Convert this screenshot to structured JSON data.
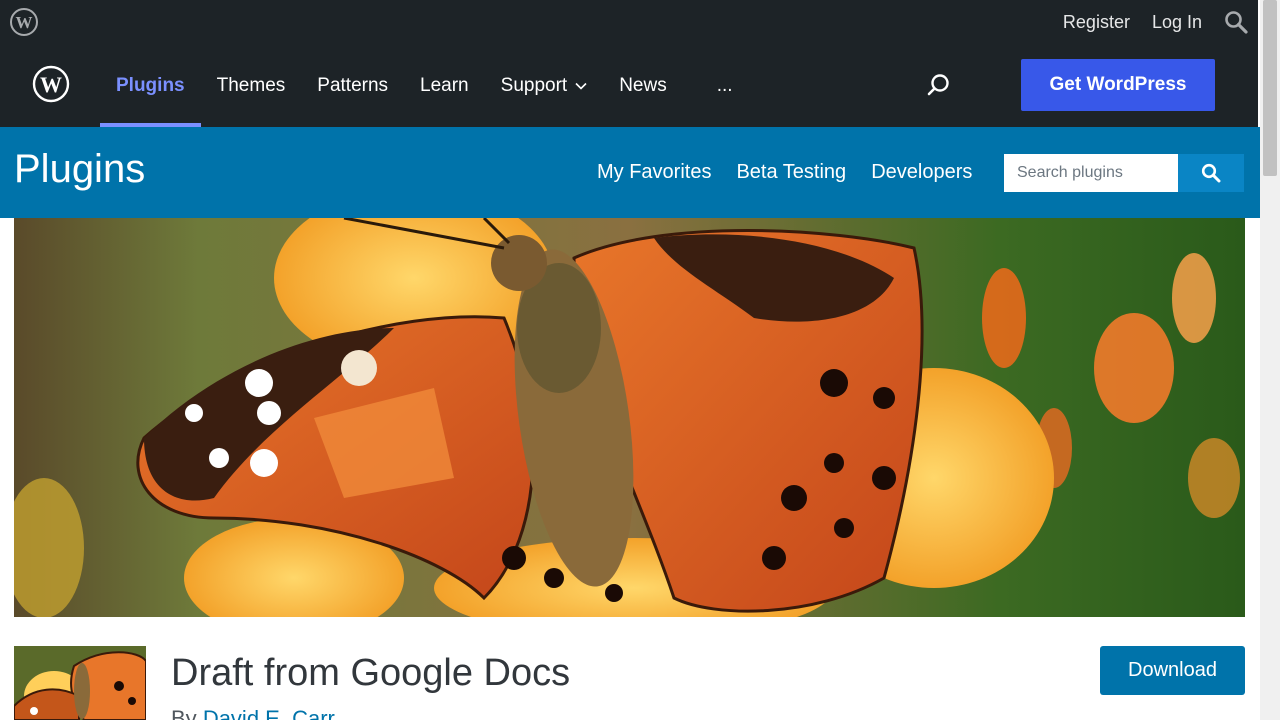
{
  "admin_bar": {
    "register": "Register",
    "login": "Log In"
  },
  "nav": {
    "items": [
      {
        "label": "Plugins",
        "active": true
      },
      {
        "label": "Themes"
      },
      {
        "label": "Patterns"
      },
      {
        "label": "Learn"
      },
      {
        "label": "Support",
        "has_dropdown": true
      },
      {
        "label": "News"
      },
      {
        "label": "..."
      }
    ],
    "cta": "Get WordPress"
  },
  "plugins_bar": {
    "title": "Plugins",
    "links": [
      "My Favorites",
      "Beta Testing",
      "Developers"
    ],
    "search_placeholder": "Search plugins"
  },
  "plugin": {
    "title": "Draft from Google Docs",
    "by": "By",
    "author": "David E. Carr",
    "download_label": "Download"
  },
  "colors": {
    "admin_bg": "#1d2327",
    "accent_nav": "#7b90ff",
    "cta": "#3858e9",
    "plugins_blue": "#0073aa"
  },
  "icons": [
    "wordpress-logo-icon",
    "search-icon",
    "chevron-down-icon",
    "butterfly-banner-image"
  ]
}
